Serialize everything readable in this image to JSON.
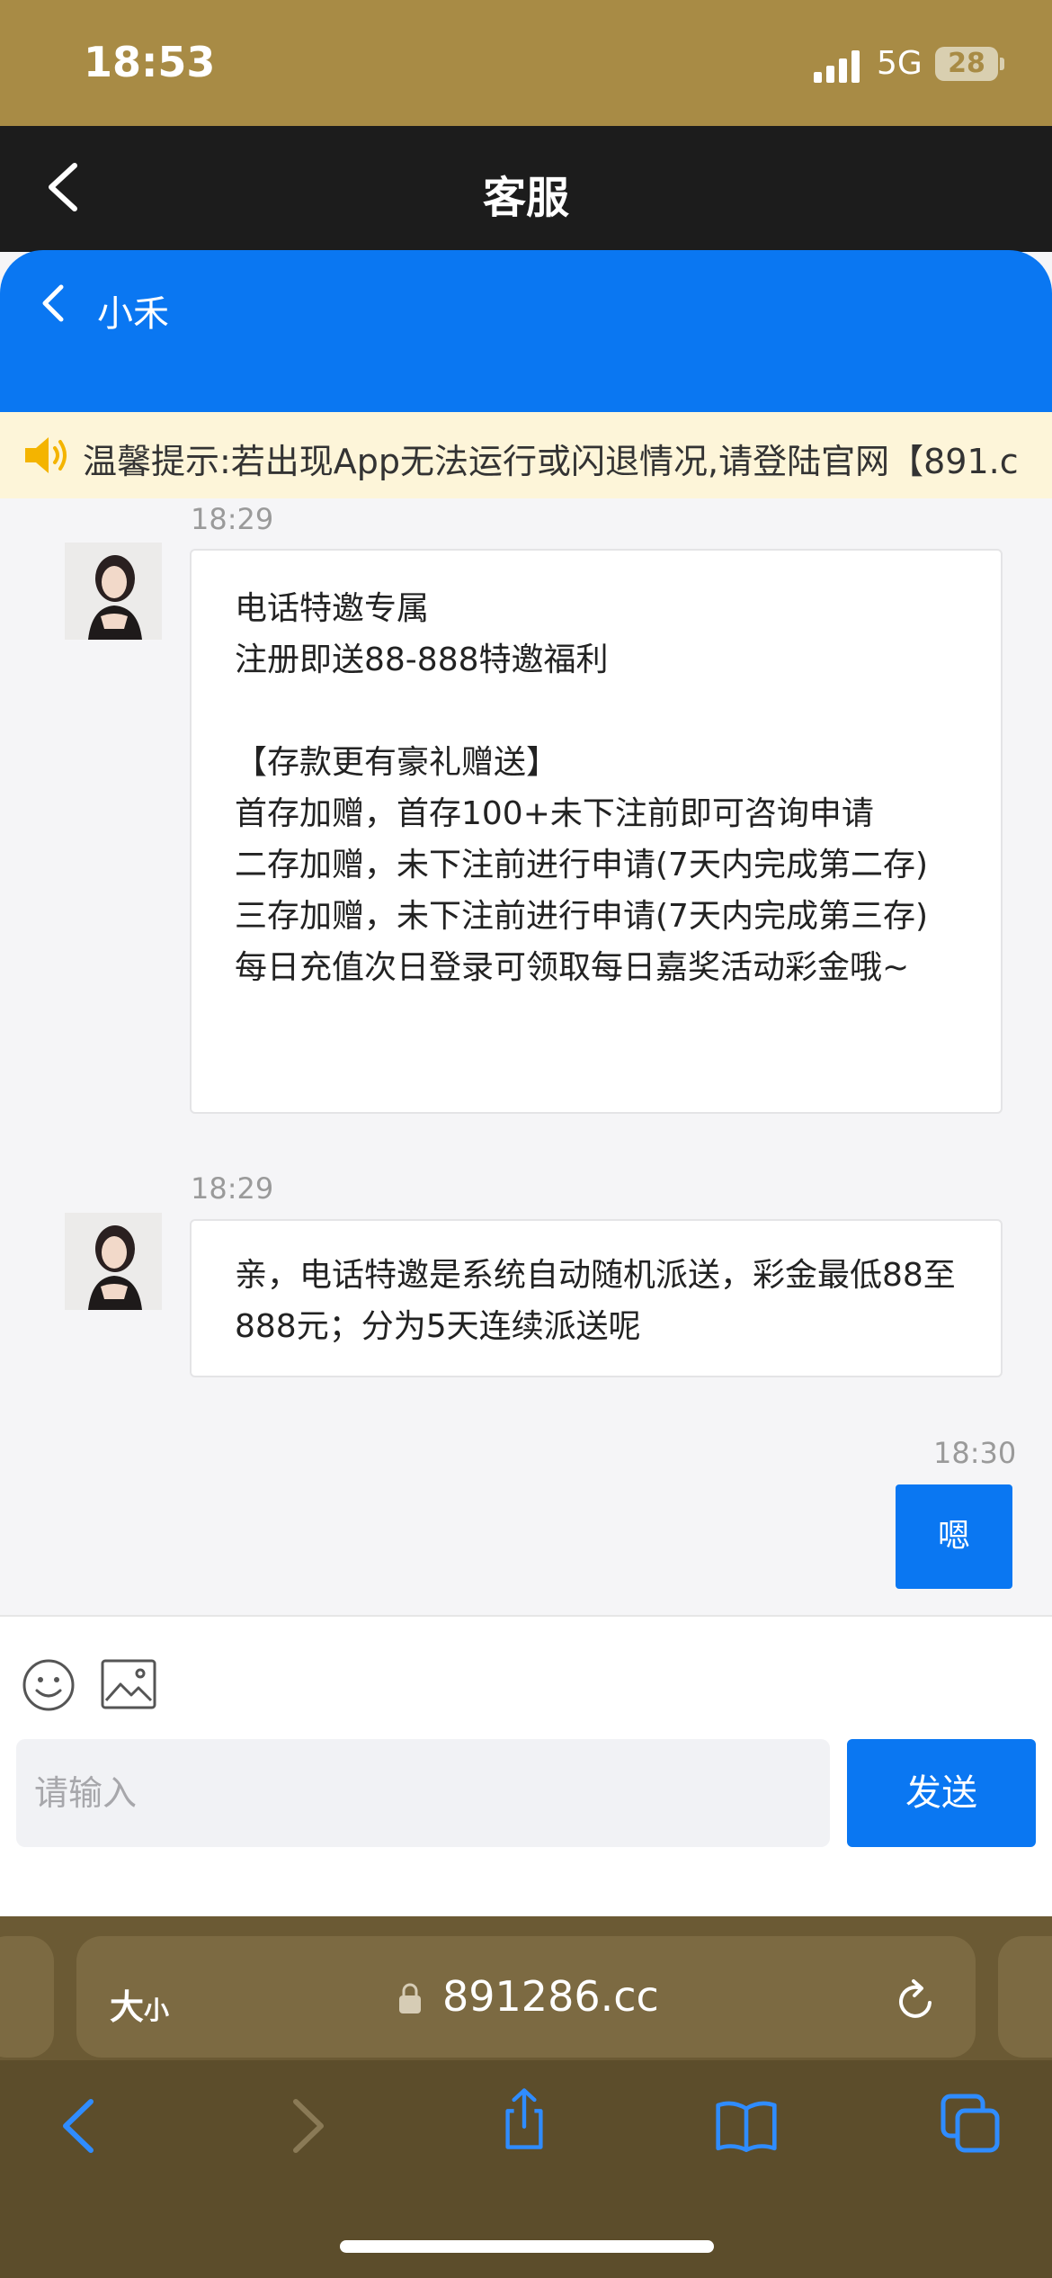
{
  "status_bar": {
    "time": "18:53",
    "network": "5G",
    "battery": "28"
  },
  "app_bar": {
    "title": "客服",
    "back_icon": "chevron-left-icon"
  },
  "chat_header": {
    "agent_name": "小禾",
    "back_icon": "chevron-left-icon"
  },
  "notice": {
    "icon": "speaker-icon",
    "text": "温馨提示:若出现App无法运行或闪退情况,请登陆官网【891.c"
  },
  "messages": [
    {
      "time": "18:29",
      "from": "agent",
      "text": "电话特邀专属\n注册即送88-888特邀福利\n\n【存款更有豪礼赠送】\n首存加赠，首存100+未下注前即可咨询申请\n二存加赠，未下注前进行申请(7天内完成第二存)\n三存加赠，未下注前进行申请(7天内完成第三存)\n每日充值次日登录可领取每日嘉奖活动彩金哦~"
    },
    {
      "time": "18:29",
      "from": "agent",
      "text": "亲，电话特邀是系统自动随机派送，彩金最低88至888元；分为5天连续派送呢"
    },
    {
      "time": "18:30",
      "from": "user",
      "text": "嗯"
    }
  ],
  "composer": {
    "placeholder": "请输入",
    "value": "",
    "send_label": "发送",
    "emoji_icon": "emoji-icon",
    "image_icon": "image-icon"
  },
  "browser": {
    "size_label_big": "大",
    "size_label_small": "小",
    "url": "891286.cc"
  },
  "colors": {
    "accent": "#0a77f2",
    "status_bar": "#a88b45",
    "browser_bar": "#5c4d2b"
  }
}
